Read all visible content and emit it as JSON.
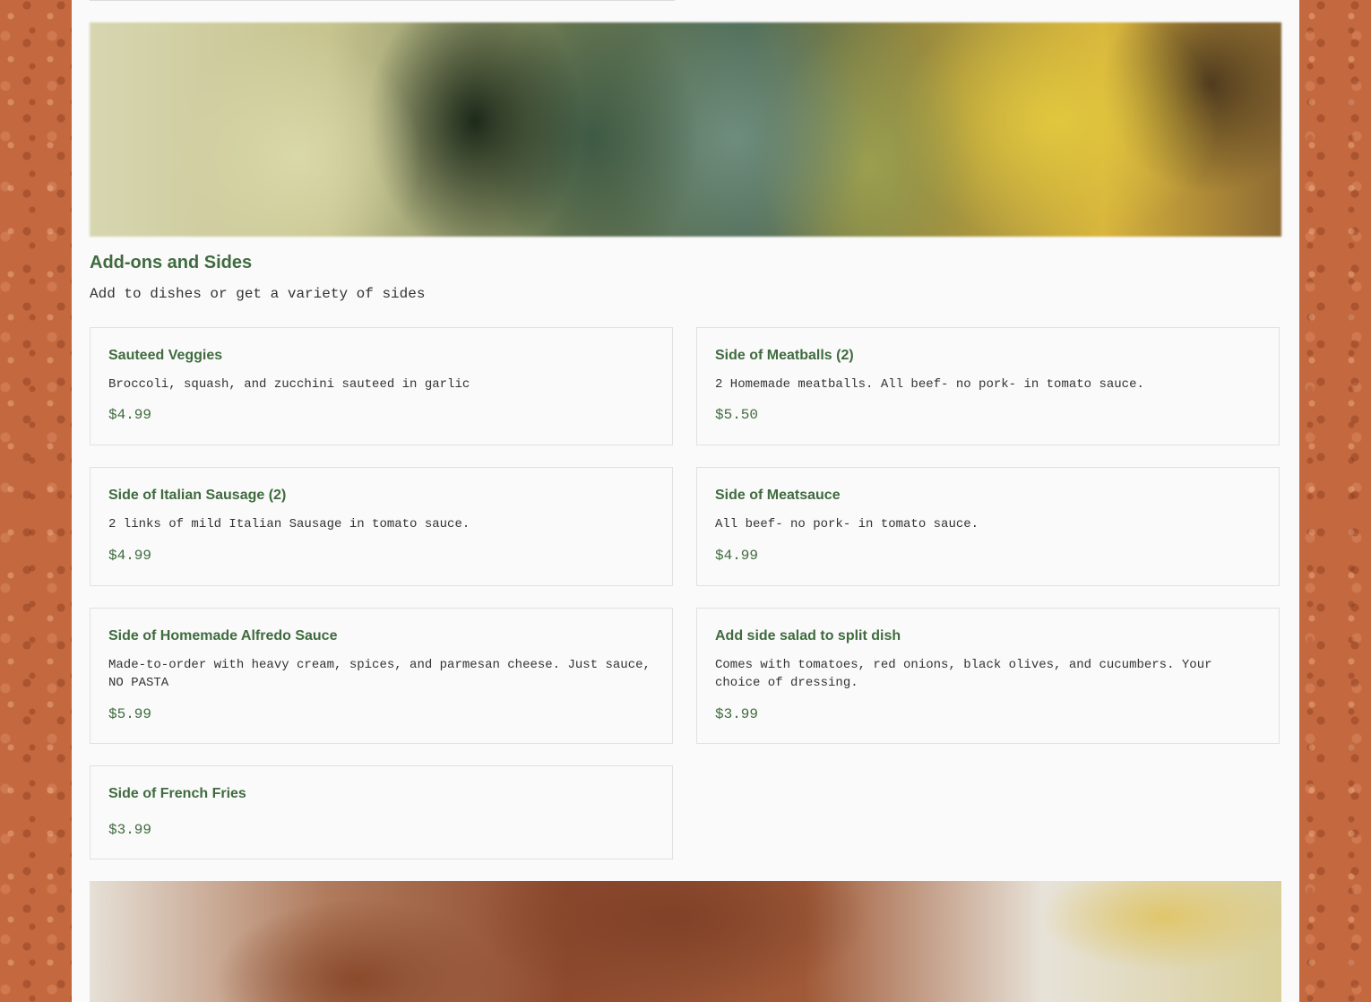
{
  "section": {
    "title": "Add-ons and Sides",
    "subtitle": "Add to dishes or get a variety of sides"
  },
  "items": [
    {
      "name": "Sauteed Veggies",
      "description": "Broccoli, squash, and zucchini sauteed in garlic",
      "price": "$4.99"
    },
    {
      "name": "Side of Meatballs (2)",
      "description": "2 Homemade meatballs. All beef- no pork- in tomato sauce.",
      "price": "$5.50"
    },
    {
      "name": "Side of Italian Sausage (2)",
      "description": "2 links of mild Italian Sausage in tomato sauce.",
      "price": "$4.99"
    },
    {
      "name": "Side of Meatsauce",
      "description": "All beef- no pork- in tomato sauce.",
      "price": "$4.99"
    },
    {
      "name": "Side of Homemade Alfredo Sauce",
      "description": "Made-to-order with heavy cream, spices, and parmesan cheese. Just sauce, NO PASTA",
      "price": "$5.99"
    },
    {
      "name": "Add side salad to split dish",
      "description": "Comes with tomatoes, red onions, black olives, and cucumbers. Your choice of dressing.",
      "price": "$3.99"
    },
    {
      "name": "Side of French Fries",
      "price": "$3.99"
    }
  ]
}
